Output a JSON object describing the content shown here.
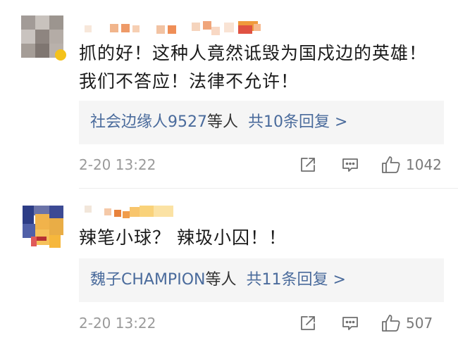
{
  "comments": [
    {
      "body_lines": [
        "抓的好！这种人竟然诋毁为国戍边的英雄！",
        "我们不答应！法律不允许！"
      ],
      "reply_box": {
        "users": "社会边缘人9527",
        "suffix": "等人",
        "count_text": "共10条回复 >"
      },
      "timestamp": "2-20 13:22",
      "likes": "1042",
      "icons": [
        "share-icon",
        "comment-icon",
        "thumbs-up-icon"
      ]
    },
    {
      "body_lines": [
        "辣笔小球？ 辣圾小囚！！"
      ],
      "reply_box": {
        "users": "魏子CHAMPION",
        "suffix": "等人",
        "count_text": "共11条回复 >"
      },
      "timestamp": "2-20 13:22",
      "likes": "507",
      "icons": [
        "share-icon",
        "comment-icon",
        "thumbs-up-icon"
      ]
    }
  ],
  "colors": {
    "link": "#4a6b9c",
    "reply_box_bg": "#f5f5f5",
    "meta": "#9a9a9a",
    "text": "#1a1a1a"
  }
}
